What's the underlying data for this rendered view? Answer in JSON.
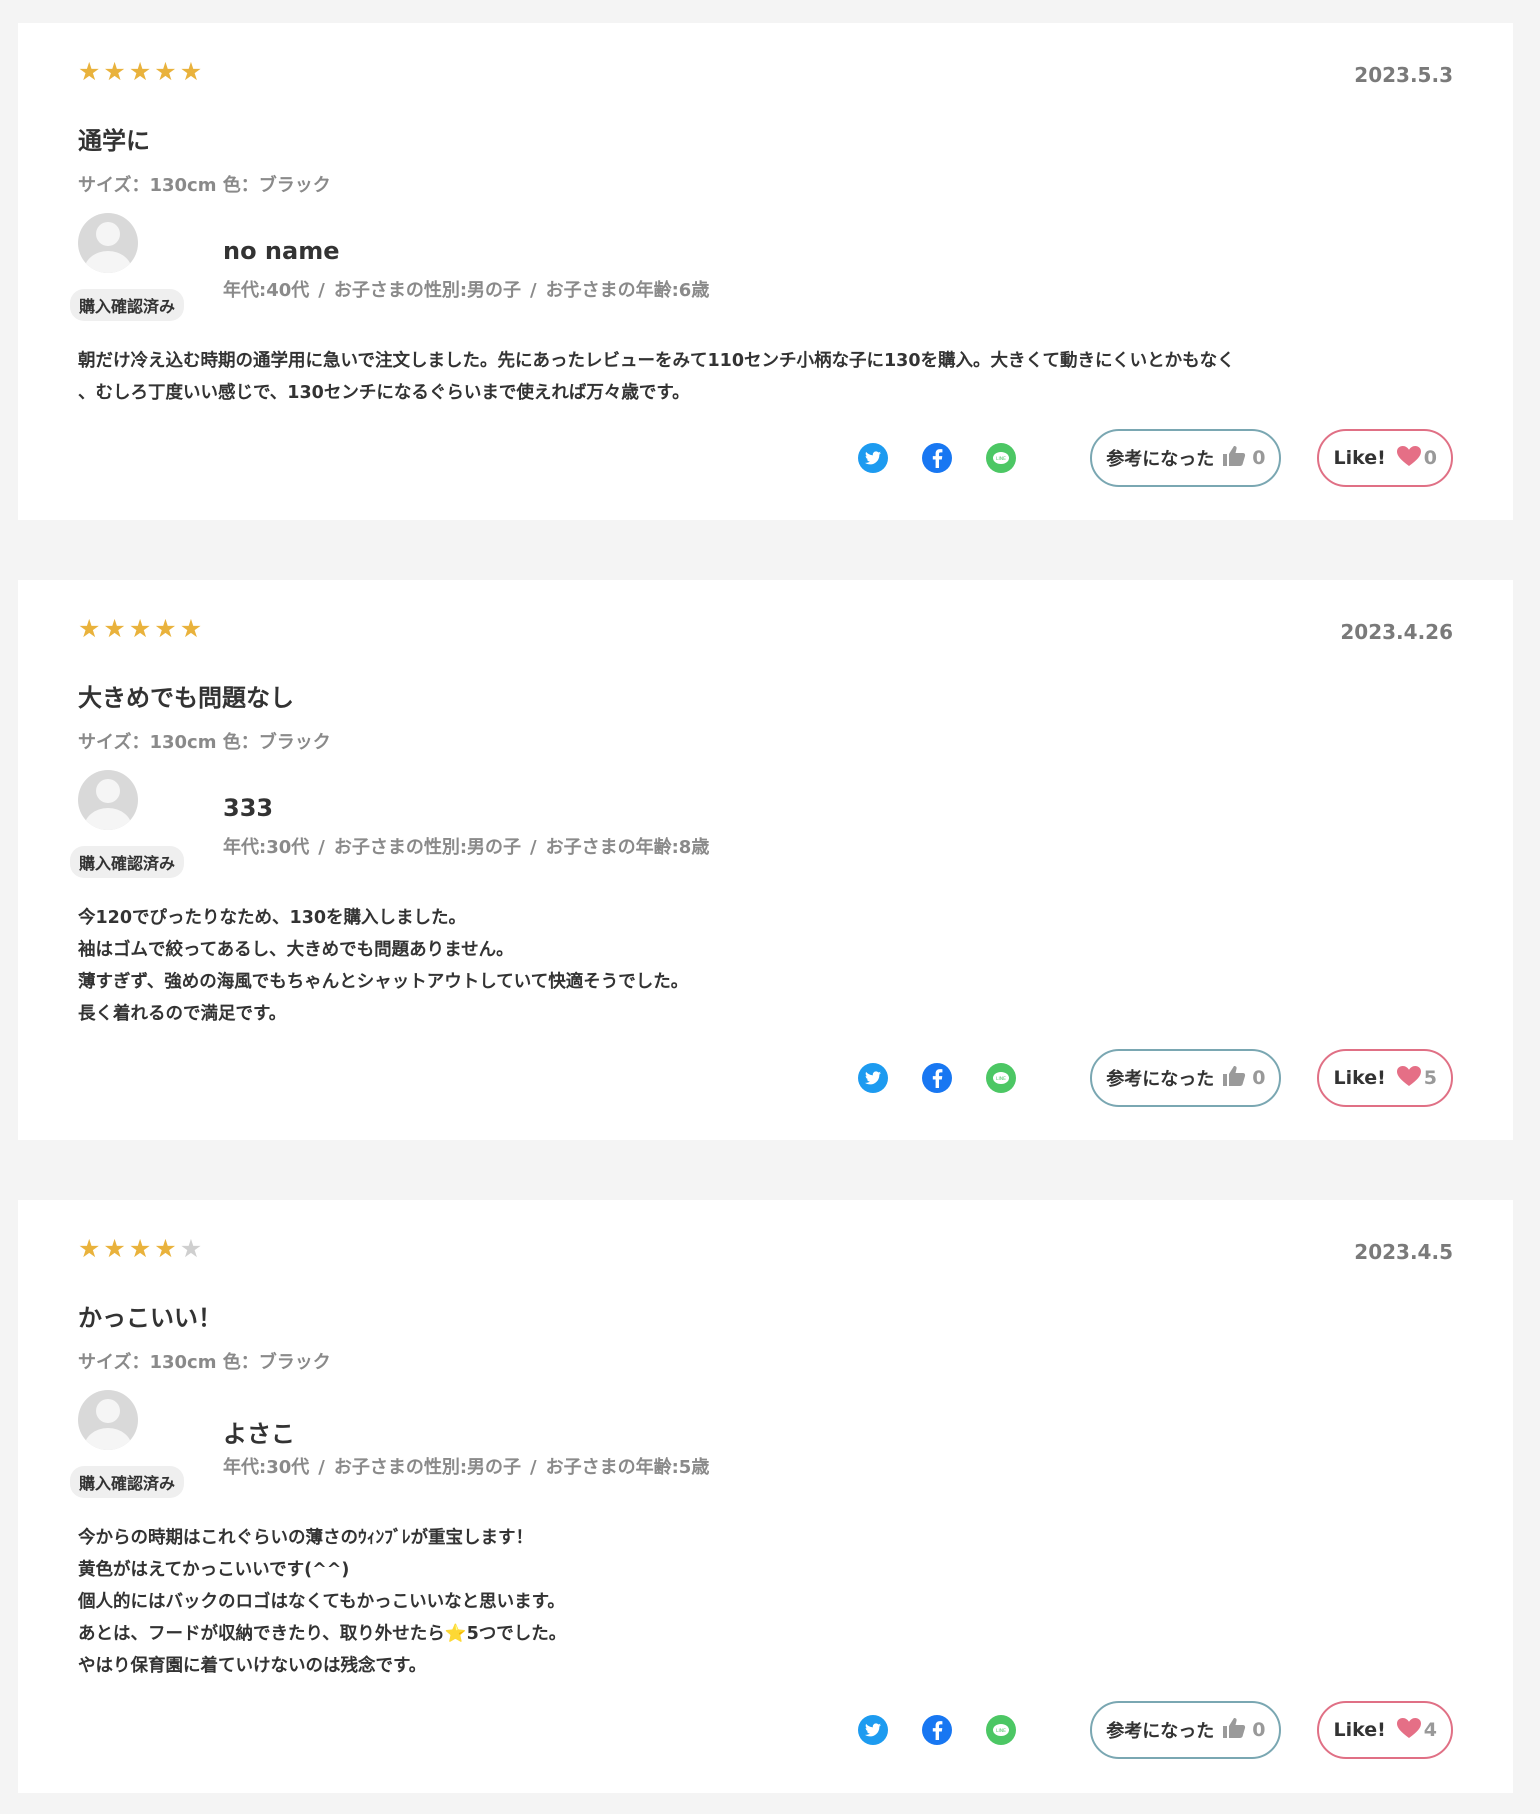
{
  "colors": {
    "star_on": "#e9b23c",
    "star_off": "#cfcfcf",
    "helpful_border": "#7aa7b2",
    "like_border": "#e07085",
    "heart": "#e56f86"
  },
  "reviews": [
    {
      "rating": 5,
      "date": "2023.5.3",
      "title": "通学に",
      "variant": "サイズ：130cm 色：ブラック",
      "username": "no name",
      "verified": "購入確認済み",
      "age": "年代:40代",
      "gender": "お子さまの性別:男の子",
      "child_age": "お子さまの年齢:6歳",
      "body": "朝だけ冷え込む時期の通学用に急いで注文しました。先にあったレビューをみて110センチ小柄な子に130を購入。大きくて動きにくいとかもなく\n、むしろ丁度いい感じで、130センチになるぐらいまで使えれば万々歳です。",
      "helpful_label": "参考になった",
      "helpful_count": "0",
      "like_label": "Like!",
      "like_count": "0"
    },
    {
      "rating": 5,
      "date": "2023.4.26",
      "title": "大きめでも問題なし",
      "variant": "サイズ：130cm 色：ブラック",
      "username": "333",
      "verified": "購入確認済み",
      "age": "年代:30代",
      "gender": "お子さまの性別:男の子",
      "child_age": "お子さまの年齢:8歳",
      "body": "今120でぴったりなため、130を購入しました。\n袖はゴムで絞ってあるし、大きめでも問題ありません。\n薄すぎず、強めの海風でもちゃんとシャットアウトしていて快適そうでした。\n長く着れるので満足です。",
      "helpful_label": "参考になった",
      "helpful_count": "0",
      "like_label": "Like!",
      "like_count": "5"
    },
    {
      "rating": 4,
      "date": "2023.4.5",
      "title": "かっこいい！",
      "variant": "サイズ：130cm 色：ブラック",
      "username": "よさこ",
      "verified": "購入確認済み",
      "age": "年代:30代",
      "gender": "お子さまの性別:男の子",
      "child_age": "お子さまの年齢:5歳",
      "body": "今からの時期はこれぐらいの薄さのｳｨﾝﾌﾞﾚが重宝します！\n黄色がはえてかっこいいです(^^)\n個人的にはバックのロゴはなくてもかっこいいなと思います。\nあとは、フードが収納できたり、取り外せたら⭐5つでした。\nやはり保育園に着ていけないのは残念です。",
      "helpful_label": "参考になった",
      "helpful_count": "0",
      "like_label": "Like!",
      "like_count": "4"
    }
  ]
}
